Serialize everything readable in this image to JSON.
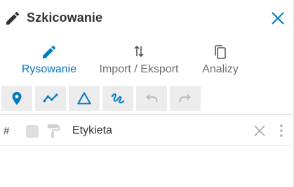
{
  "header": {
    "title": "Szkicowanie",
    "title_icon": "pencil-icon",
    "close_icon": "close-icon"
  },
  "tabs": [
    {
      "label": "Rysowanie",
      "icon": "pencil-icon",
      "active": true
    },
    {
      "label": "Import / Eksport",
      "icon": "arrows-updown-icon",
      "active": false
    },
    {
      "label": "Analizy",
      "icon": "copy-icon",
      "active": false
    }
  ],
  "toolbar": {
    "buttons": [
      "point-marker-icon",
      "polyline-icon",
      "triangle-icon",
      "freehand-icon",
      "undo-icon",
      "redo-icon"
    ]
  },
  "list": {
    "hash_header": "#",
    "label_header": "Etykieta"
  },
  "colors": {
    "accent": "#0079c1",
    "disabled": "#b8b8b8",
    "text": "#323232",
    "button_bg": "#ececec"
  }
}
